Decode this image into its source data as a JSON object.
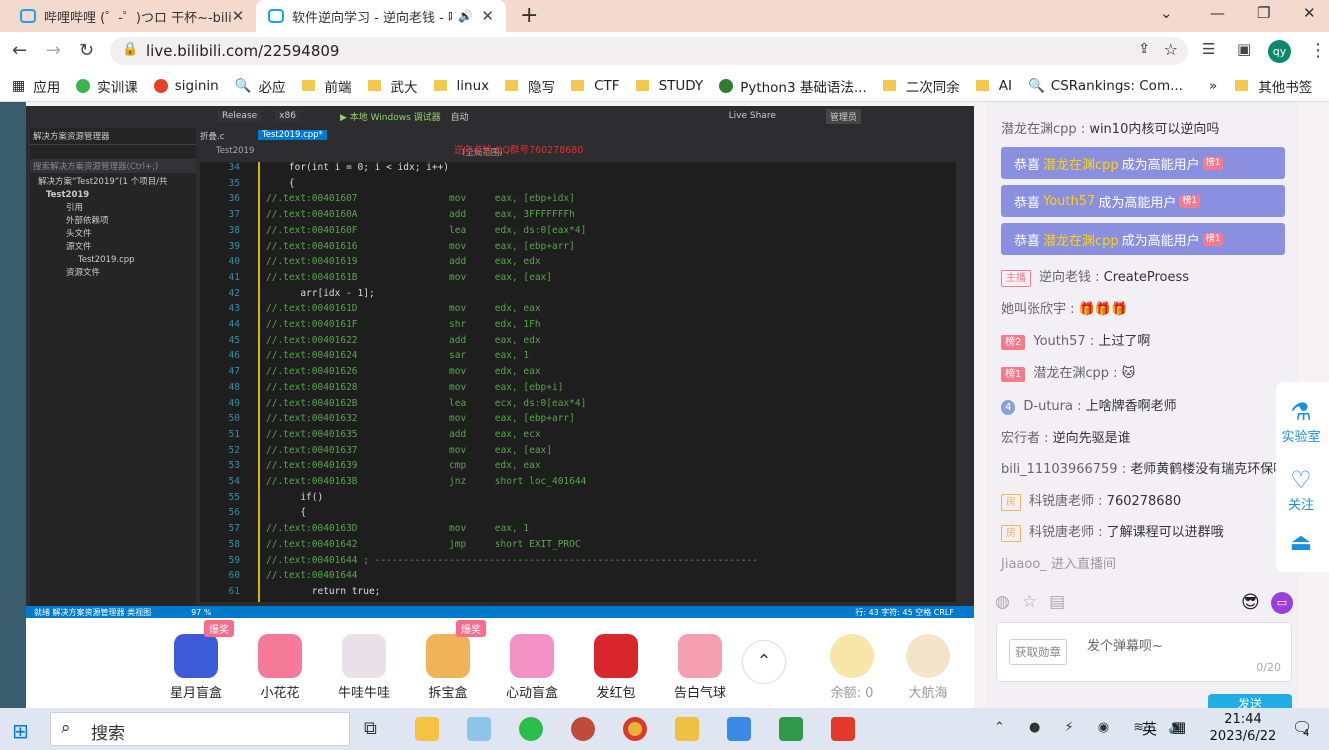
{
  "tabs": [
    {
      "title": "哔哩哔哩 (゜-゜)つロ 干杯~-bili",
      "active": false
    },
    {
      "title": "软件逆向学习 - 逆向老钱 - 哔",
      "active": true
    }
  ],
  "address": {
    "url": "live.bilibili.com/22594809",
    "avatar": "qy"
  },
  "bookmarks": [
    "应用",
    "实训课",
    "siginin",
    "必应",
    "前端",
    "武大",
    "linux",
    "隐写",
    "CTF",
    "STUDY",
    "Python3 基础语法...",
    "二次同余",
    "AI",
    "CSRankings: Com..."
  ],
  "bookmarks_more": "»",
  "other_bookmarks": "其他书签",
  "ide": {
    "config": "Release",
    "platform": "x86",
    "run": "▶ 本地 Windows 调试器",
    "auto": "自动",
    "live_share": "Live Share",
    "admin": "管理员",
    "sol_title": "解决方案资源管理器",
    "sol_search": "搜索解决方案资源管理器(Ctrl+;)",
    "tree": [
      "解决方案“Test2019”(1 个项目/共",
      "Test2019",
      "引用",
      "外部依赖项",
      "头文件",
      "源文件",
      "Test2019.cpp",
      "资源文件"
    ],
    "tab1": "折叠.c",
    "tab2": "Test2019.cpp*",
    "scope": "Test2019",
    "scope2": "(全局范围)",
    "watermark": "逆向老钱 QQ群号760278680",
    "status": "就绪  解决方案资源管理器  类视图",
    "zoom": "97 %",
    "pos": "行: 43  字符: 45  空格  CRLF"
  },
  "code": [
    {
      "n": "34",
      "t": "    for(int i = 0; i < idx; i++)"
    },
    {
      "n": "35",
      "t": "    {"
    },
    {
      "n": "36",
      "t": "//.text:00401607                mov     eax, [ebp+idx]"
    },
    {
      "n": "37",
      "t": "//.text:0040160A                add     eax, 3FFFFFFFh"
    },
    {
      "n": "38",
      "t": "//.text:0040160F                lea     edx, ds:0[eax*4]"
    },
    {
      "n": "39",
      "t": "//.text:00401616                mov     eax, [ebp+arr]"
    },
    {
      "n": "40",
      "t": "//.text:00401619                add     eax, edx"
    },
    {
      "n": "41",
      "t": "//.text:0040161B                mov     eax, [eax]"
    },
    {
      "n": "42",
      "t": "      arr[idx - 1];"
    },
    {
      "n": "43",
      "t": "//.text:0040161D                mov     edx, eax"
    },
    {
      "n": "44",
      "t": "//.text:0040161F                shr     edx, 1Fh"
    },
    {
      "n": "45",
      "t": "//.text:00401622                add     eax, edx"
    },
    {
      "n": "46",
      "t": "//.text:00401624                sar     eax, 1"
    },
    {
      "n": "47",
      "t": "//.text:00401626                mov     edx, eax"
    },
    {
      "n": "48",
      "t": "//.text:00401628                mov     eax, [ebp+i]"
    },
    {
      "n": "49",
      "t": "//.text:0040162B                lea     ecx, ds:0[eax*4]"
    },
    {
      "n": "50",
      "t": "//.text:00401632                mov     eax, [ebp+arr]"
    },
    {
      "n": "51",
      "t": "//.text:00401635                add     eax, ecx"
    },
    {
      "n": "52",
      "t": "//.text:00401637                mov     eax, [eax]"
    },
    {
      "n": "53",
      "t": "//.text:00401639                cmp     edx, eax"
    },
    {
      "n": "54",
      "t": "//.text:0040163B                jnz     short loc_401644"
    },
    {
      "n": "55",
      "t": "      if()"
    },
    {
      "n": "56",
      "t": "      {"
    },
    {
      "n": "57",
      "t": "//.text:0040163D                mov     eax, 1"
    },
    {
      "n": "58",
      "t": "//.text:00401642                jmp     short EXIT_PROC"
    },
    {
      "n": "59",
      "t": "//.text:00401644 ; -------------------------------------------------------------------"
    },
    {
      "n": "60",
      "t": "//.text:00401644"
    },
    {
      "n": "61",
      "t": "        return true;"
    }
  ],
  "gifts": [
    {
      "name": "星月盲盒",
      "hot": "爆奖",
      "color": "#3d5bd8"
    },
    {
      "name": "小花花",
      "hot": "",
      "color": "#f57a9a"
    },
    {
      "name": "牛哇牛哇",
      "hot": "",
      "color": "#eae1e8"
    },
    {
      "name": "拆宝盒",
      "hot": "爆奖",
      "color": "#f0b35a"
    },
    {
      "name": "心动盲盒",
      "hot": "",
      "color": "#f390c4"
    },
    {
      "name": "发红包",
      "hot": "",
      "color": "#d9262c"
    },
    {
      "name": "告白气球",
      "hot": "",
      "color": "#f4a0b0"
    }
  ],
  "balance": "余额: 0",
  "captain": "大航海",
  "chat": {
    "top": {
      "name": "潜龙在渊cpp",
      "sep": " : ",
      "text": "win10内核可以逆向吗"
    },
    "highlights": [
      {
        "pre": "恭喜",
        "user": "潜龙在渊cpp",
        "post": "成为高能用户",
        "lvl": "榜1"
      },
      {
        "pre": "恭喜",
        "user": "Youth57",
        "post": "成为高能用户",
        "lvl": "榜1"
      },
      {
        "pre": "恭喜",
        "user": "潜龙在渊cpp",
        "post": "成为高能用户",
        "lvl": "榜1"
      }
    ],
    "messages": [
      {
        "badge": "主播",
        "name": "逆向老钱",
        "sep": " : ",
        "text": "CreateProess"
      },
      {
        "badge": "",
        "name": "她叫张欣宇",
        "sep": " : ",
        "text": ""
      },
      {
        "badge": "榜2",
        "name": "Youth57",
        "sep": " : ",
        "text": "上过了啊"
      },
      {
        "badge": "榜1",
        "name": "潜龙在渊cpp",
        "sep": " : ",
        "text": ""
      },
      {
        "badge": "4",
        "name": "D-utura",
        "sep": " : ",
        "text": "上啥牌香啊老师"
      },
      {
        "badge": "",
        "name": "宏行者",
        "sep": " : ",
        "text": "逆向先驱是谁"
      },
      {
        "badge": "",
        "name": "bili_11103966759",
        "sep": " : ",
        "text": "老师黄鹤楼没有瑞克环保啊"
      },
      {
        "badge": "房",
        "name": "科锐唐老师",
        "sep": " : ",
        "text": "760278680"
      },
      {
        "badge": "房",
        "name": "科锐唐老师",
        "sep": " : ",
        "text": "了解课程可以进群哦"
      },
      {
        "badge": "",
        "name": "Jiaaoo_",
        "sep": " ",
        "text": "进入直播间"
      }
    ],
    "medal_btn": "获取勋章",
    "placeholder": "发个弹幕呗~",
    "counter": "0/20",
    "send": "发送"
  },
  "side": [
    "实验室",
    "关注",
    ""
  ],
  "taskbar": {
    "search": "搜索",
    "time": "21:44",
    "date": "2023/6/22",
    "ime": "英",
    "notif": "4"
  },
  "colors": {
    "accent": "#1a8fe0",
    "highlight_bg": "#8a8fe0",
    "taskbar": "#dfe6f2"
  }
}
